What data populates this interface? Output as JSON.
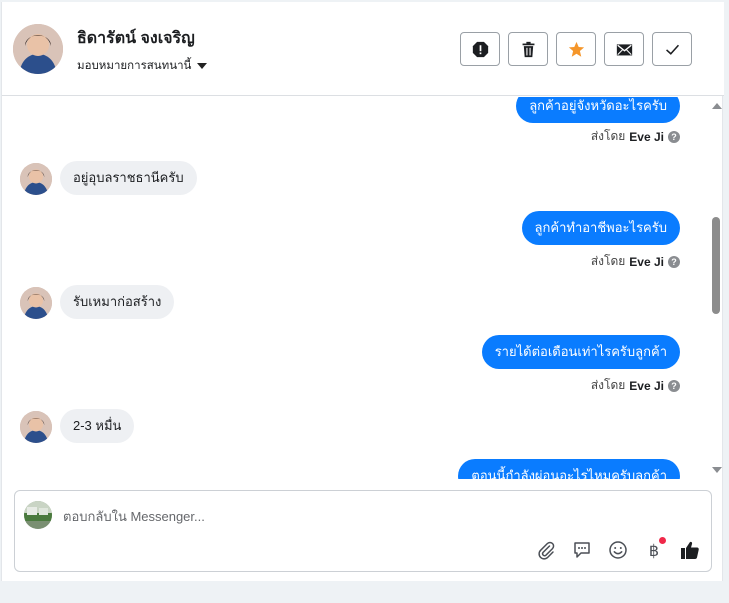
{
  "header": {
    "contact_name": "ธิดารัตน์ จงเจริญ",
    "assign_label": "มอบหมายการสนทนานี้",
    "toolbar": [
      {
        "name": "spam-button",
        "icon": "alert-octagon-icon"
      },
      {
        "name": "delete-button",
        "icon": "trash-icon"
      },
      {
        "name": "star-button",
        "icon": "star-icon"
      },
      {
        "name": "mark-unread-button",
        "icon": "envelope-icon"
      },
      {
        "name": "mark-done-button",
        "icon": "check-icon"
      }
    ]
  },
  "messages": [
    {
      "direction": "out",
      "text": "ลูกค้าอยู่จังหวัดอะไรครับ",
      "sent_by_prefix": "ส่งโดย",
      "sent_by_name": "Eve Ji"
    },
    {
      "direction": "in",
      "text": "อยู่อุบลราชธานีครับ"
    },
    {
      "direction": "out",
      "text": "ลูกค้าทำอาชีพอะไรครับ",
      "sent_by_prefix": "ส่งโดย",
      "sent_by_name": "Eve Ji"
    },
    {
      "direction": "in",
      "text": "รับเหมาก่อสร้าง"
    },
    {
      "direction": "out",
      "text": "รายได้ต่อเดือนเท่าไรครับลูกค้า",
      "sent_by_prefix": "ส่งโดย",
      "sent_by_name": "Eve Ji"
    },
    {
      "direction": "in",
      "text": "2-3 หมื่น"
    },
    {
      "direction": "out",
      "text": "ตอนนี้กำลังผ่อนอะไรไหมครับลูกค้า"
    }
  ],
  "composer": {
    "placeholder": "ตอบกลับใน Messenger...",
    "tools": [
      "paperclip-icon",
      "chat-bubble-icon",
      "smiley-icon",
      "baht-icon",
      "thumbs-up-icon"
    ],
    "baht_symbol": "฿"
  },
  "colors": {
    "outgoing_bubble": "#0a7cff",
    "incoming_bubble": "#eef0f3",
    "star": "#f5962a",
    "notification_dot": "#f02849"
  }
}
